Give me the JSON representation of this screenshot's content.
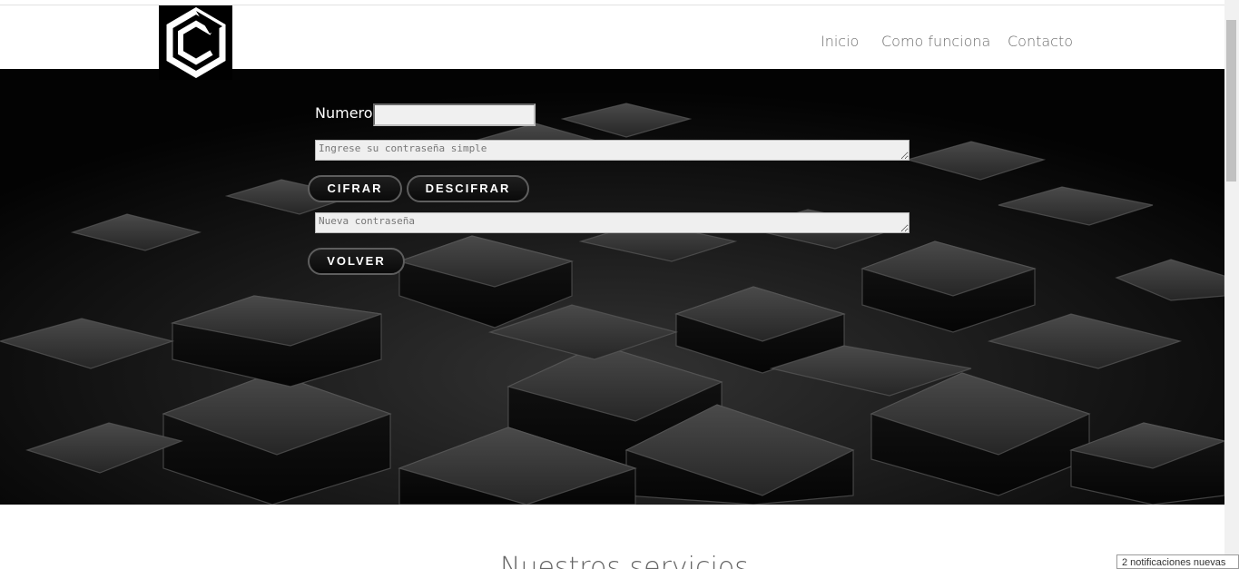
{
  "header": {
    "logo_icon": "hexagon-c-logo-icon",
    "nav": [
      "Inicio",
      "Como funciona",
      "Contacto"
    ]
  },
  "form": {
    "numero_label": "Numero",
    "numero_value": "",
    "plain_placeholder": "Ingrese su contraseña simple",
    "result_placeholder": "Nueva contraseña",
    "cifrar_label": "CIFRAR",
    "descifrar_label": "DESCIFRAR",
    "volver_label": "VOLVER"
  },
  "sections": {
    "services_title": "Nuestros servicios"
  },
  "notifications": {
    "text": "2 notificaciones nuevas"
  },
  "colors": {
    "hero_background": "#050505",
    "nav_text": "#6e6e6e",
    "button_text": "#ffffff"
  }
}
